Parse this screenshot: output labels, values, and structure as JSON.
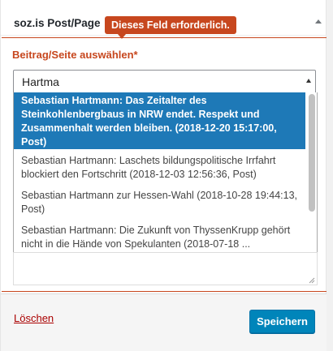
{
  "widget": {
    "title": "soz.is Post/Page",
    "tooltip": "Dieses Feld erforderlich."
  },
  "field": {
    "label": "Beitrag/Seite auswählen*",
    "search_value": "Hartma"
  },
  "options": [
    {
      "text": "Sebastian Hartmann: Das Zeitalter des Steinkohlenbergbaus in NRW endet. Respekt und Zusammenhalt werden bleiben. (2018-12-20 15:17:00, Post)",
      "highlighted": true
    },
    {
      "text": "Sebastian Hartmann: Laschets bildungspolitische Irrfahrt blockiert den Fortschritt (2018-12-03 12:56:36, Post)",
      "highlighted": false
    },
    {
      "text": "Sebastian Hartmann zur Hessen-Wahl (2018-10-28 19:44:13, Post)",
      "highlighted": false
    },
    {
      "text": "Sebastian Hartmann: Die Zukunft von ThyssenKrupp gehört nicht in die Hände von Spekulanten (2018-07-18 ...",
      "highlighted": false
    }
  ],
  "footer": {
    "delete_label": "Löschen",
    "save_label": "Speichern"
  },
  "colors": {
    "error": "#c7471e",
    "highlight": "#1e79b7",
    "primary_button": "#0085ba",
    "delete_link": "#a00"
  }
}
